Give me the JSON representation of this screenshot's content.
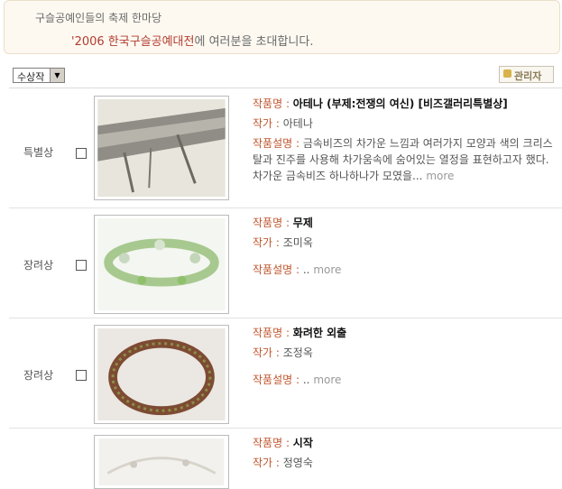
{
  "banner": {
    "line1": "구슬공예인들의 축제 한마당",
    "highlight": "'2006 한국구슬공예대전",
    "line2_rest": "에 여러분을 초대합니다."
  },
  "filter": {
    "selected": "수상작"
  },
  "admin_button": {
    "label": "관리자"
  },
  "labels": {
    "title": "작품명",
    "author": "작가",
    "desc": "작품설명",
    "more": "more"
  },
  "entries": [
    {
      "award": "특별상",
      "title": "아테나 (부제:전쟁의 여신) [비즈갤러리특별상]",
      "author": "아테나",
      "desc": "금속비즈의 차가운 느낌과 여러가지 모양과 색의 크리스탈과 진주를 사용해 차가움속에 숨어있는 열정을 표현하고자 했다. 차가운 금속비즈 하나하나가 모였을..."
    },
    {
      "award": "장려상",
      "title": "무제",
      "author": "조미옥",
      "desc": ".."
    },
    {
      "award": "장려상",
      "title": "화려한 외출",
      "author": "조정옥",
      "desc": ".."
    },
    {
      "award": "",
      "title": "시작",
      "author": "정영숙",
      "desc": ""
    }
  ]
}
